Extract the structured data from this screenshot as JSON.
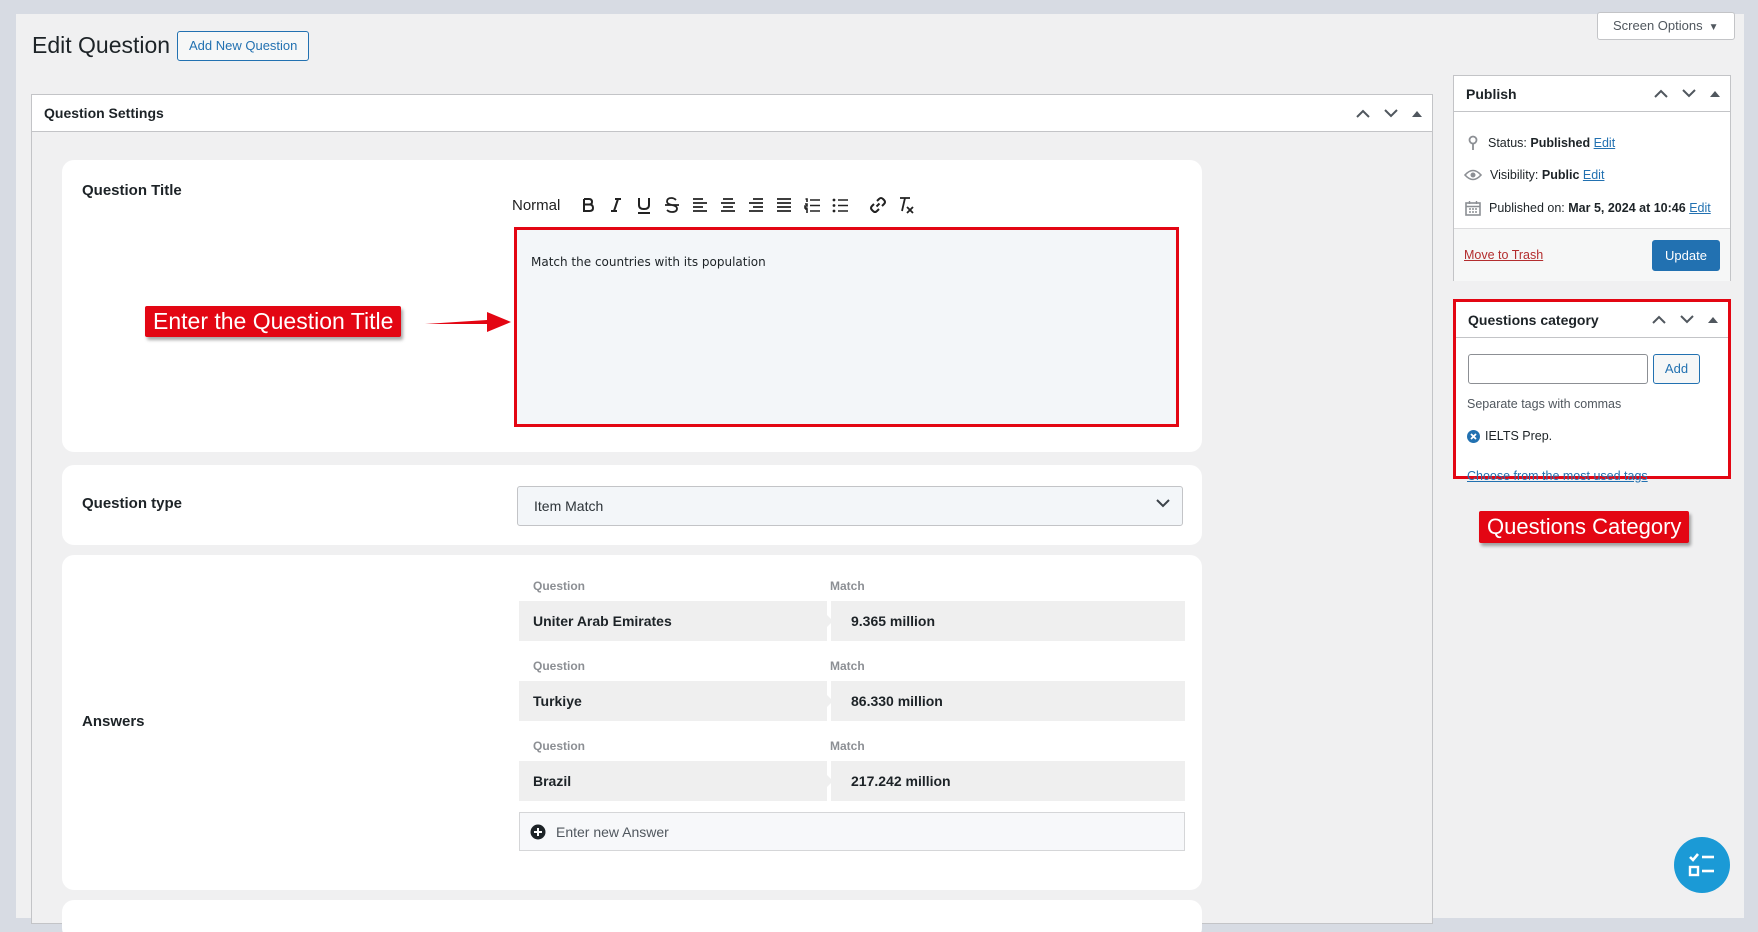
{
  "page": {
    "title": "Edit Question",
    "add_new_label": "Add New Question",
    "screen_options_label": "Screen Options"
  },
  "question_settings": {
    "header": "Question Settings",
    "title_label": "Question Title",
    "toolbar_format": "Normal",
    "toolbar_icons": [
      "bold-icon",
      "italic-icon",
      "underline-icon",
      "strikethrough-icon",
      "align-left-icon",
      "align-center-icon",
      "align-right-icon",
      "align-justify-icon",
      "ordered-list-icon",
      "bullet-list-icon",
      "link-icon",
      "clear-format-icon"
    ],
    "title_value": "Match the countries with its population",
    "type_label": "Question type",
    "type_value": "Item Match",
    "answers_label": "Answers",
    "answers": [
      {
        "q_label": "Question",
        "m_label": "Match",
        "question": "Uniter Arab Emirates",
        "match": "9.365 million"
      },
      {
        "q_label": "Question",
        "m_label": "Match",
        "question": "Turkiye",
        "match": "86.330 million"
      },
      {
        "q_label": "Question",
        "m_label": "Match",
        "question": "Brazil",
        "match": "217.242 million"
      }
    ],
    "new_answer_placeholder": "Enter new Answer"
  },
  "publish": {
    "header": "Publish",
    "status_label": "Status:",
    "status_value": "Published",
    "visibility_label": "Visibility:",
    "visibility_value": "Public",
    "published_label": "Published on:",
    "published_value": "Mar 5, 2024 at 10:46",
    "edit_label": "Edit",
    "trash_label": "Move to Trash",
    "update_label": "Update"
  },
  "category": {
    "header": "Questions category",
    "add_label": "Add",
    "hint": "Separate tags with commas",
    "tag": "IELTS Prep.",
    "choose_label": "Choose from the most used tags"
  },
  "annotations": {
    "title_callout": "Enter the Question Title",
    "category_callout": "Questions Category"
  },
  "colors": {
    "accent": "#2271b1",
    "annotation_red": "#e30613",
    "fab": "#1b9ad6"
  }
}
